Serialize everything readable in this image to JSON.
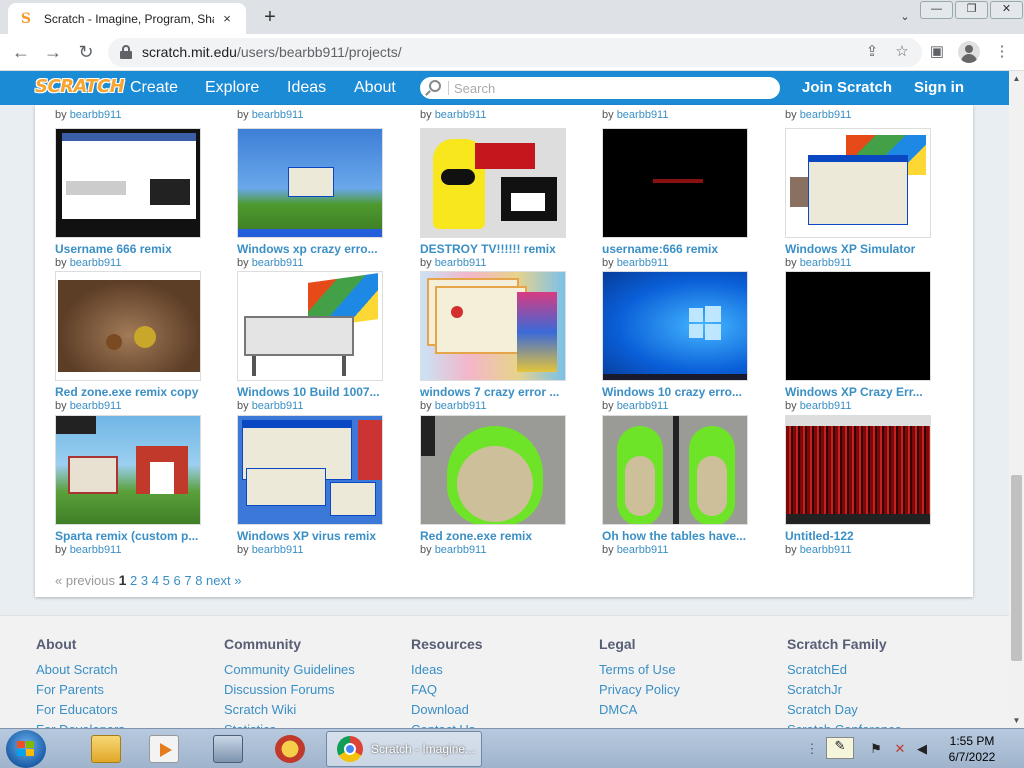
{
  "browser": {
    "tab_title": "Scratch - Imagine, Program, Share",
    "tab_close": "×",
    "new_tab": "+",
    "tab_search": "⌄",
    "back": "←",
    "forward": "→",
    "reload": "↻",
    "url_host": "scratch.mit.edu",
    "url_path": "/users/bearbb911/projects/",
    "share_icon": "⇪",
    "star_icon": "☆",
    "sidebar_icon": "▣",
    "menu_icon": "⋮",
    "win_minimize": "—",
    "win_restore": "❐",
    "win_close": "✕"
  },
  "scratch_nav": {
    "logo": "SCRATCH",
    "links": [
      "Create",
      "Explore",
      "Ideas",
      "About"
    ],
    "search_placeholder": "Search",
    "join": "Join Scratch",
    "sign_in": "Sign in"
  },
  "projects": {
    "by_label": "by",
    "partial_row_user": [
      "bearbb911",
      "bearbb911",
      "bearbb911",
      "bearbb911",
      "bearbb911"
    ],
    "rows": [
      [
        {
          "title": "Username 666 remix",
          "user": "bearbb911"
        },
        {
          "title": "Windows xp crazy erro...",
          "user": "bearbb911"
        },
        {
          "title": "DESTROY TV!!!!!! remix",
          "user": "bearbb911"
        },
        {
          "title": "username:666 remix",
          "user": "bearbb911"
        },
        {
          "title": "Windows XP Simulator",
          "user": "bearbb911"
        }
      ],
      [
        {
          "title": "Red zone.exe remix copy",
          "user": "bearbb911"
        },
        {
          "title": "Windows 10 Build 1007...",
          "user": "bearbb911"
        },
        {
          "title": "windows 7 crazy error ...",
          "user": "bearbb911"
        },
        {
          "title": "Windows 10 crazy erro...",
          "user": "bearbb911"
        },
        {
          "title": "Windows XP Crazy Err...",
          "user": "bearbb911"
        }
      ],
      [
        {
          "title": "Sparta remix (custom p...",
          "user": "bearbb911"
        },
        {
          "title": "Windows XP virus remix",
          "user": "bearbb911"
        },
        {
          "title": "Red zone.exe remix",
          "user": "bearbb911"
        },
        {
          "title": "Oh how the tables have...",
          "user": "bearbb911"
        },
        {
          "title": "Untitled-122",
          "user": "bearbb911"
        }
      ]
    ]
  },
  "pagination": {
    "previous": "« previous",
    "current": "1",
    "pages": [
      "2",
      "3",
      "4",
      "5",
      "6",
      "7",
      "8"
    ],
    "next": "next »"
  },
  "footer": {
    "columns": [
      {
        "heading": "About",
        "links": [
          "About Scratch",
          "For Parents",
          "For Educators",
          "For Developers"
        ]
      },
      {
        "heading": "Community",
        "links": [
          "Community Guidelines",
          "Discussion Forums",
          "Scratch Wiki",
          "Statistics"
        ]
      },
      {
        "heading": "Resources",
        "links": [
          "Ideas",
          "FAQ",
          "Download",
          "Contact Us"
        ]
      },
      {
        "heading": "Legal",
        "links": [
          "Terms of Use",
          "Privacy Policy",
          "DMCA"
        ]
      },
      {
        "heading": "Scratch Family",
        "links": [
          "ScratchEd",
          "ScratchJr",
          "Scratch Day",
          "Scratch Conference"
        ]
      }
    ]
  },
  "taskbar": {
    "active_window": "Scratch - Imagine...",
    "time": "1:55 PM",
    "date": "6/7/2022"
  },
  "colors": {
    "scratch_blue": "#1c8bd6",
    "link_blue": "#3a8fc5",
    "logo_orange": "#f7a531"
  }
}
